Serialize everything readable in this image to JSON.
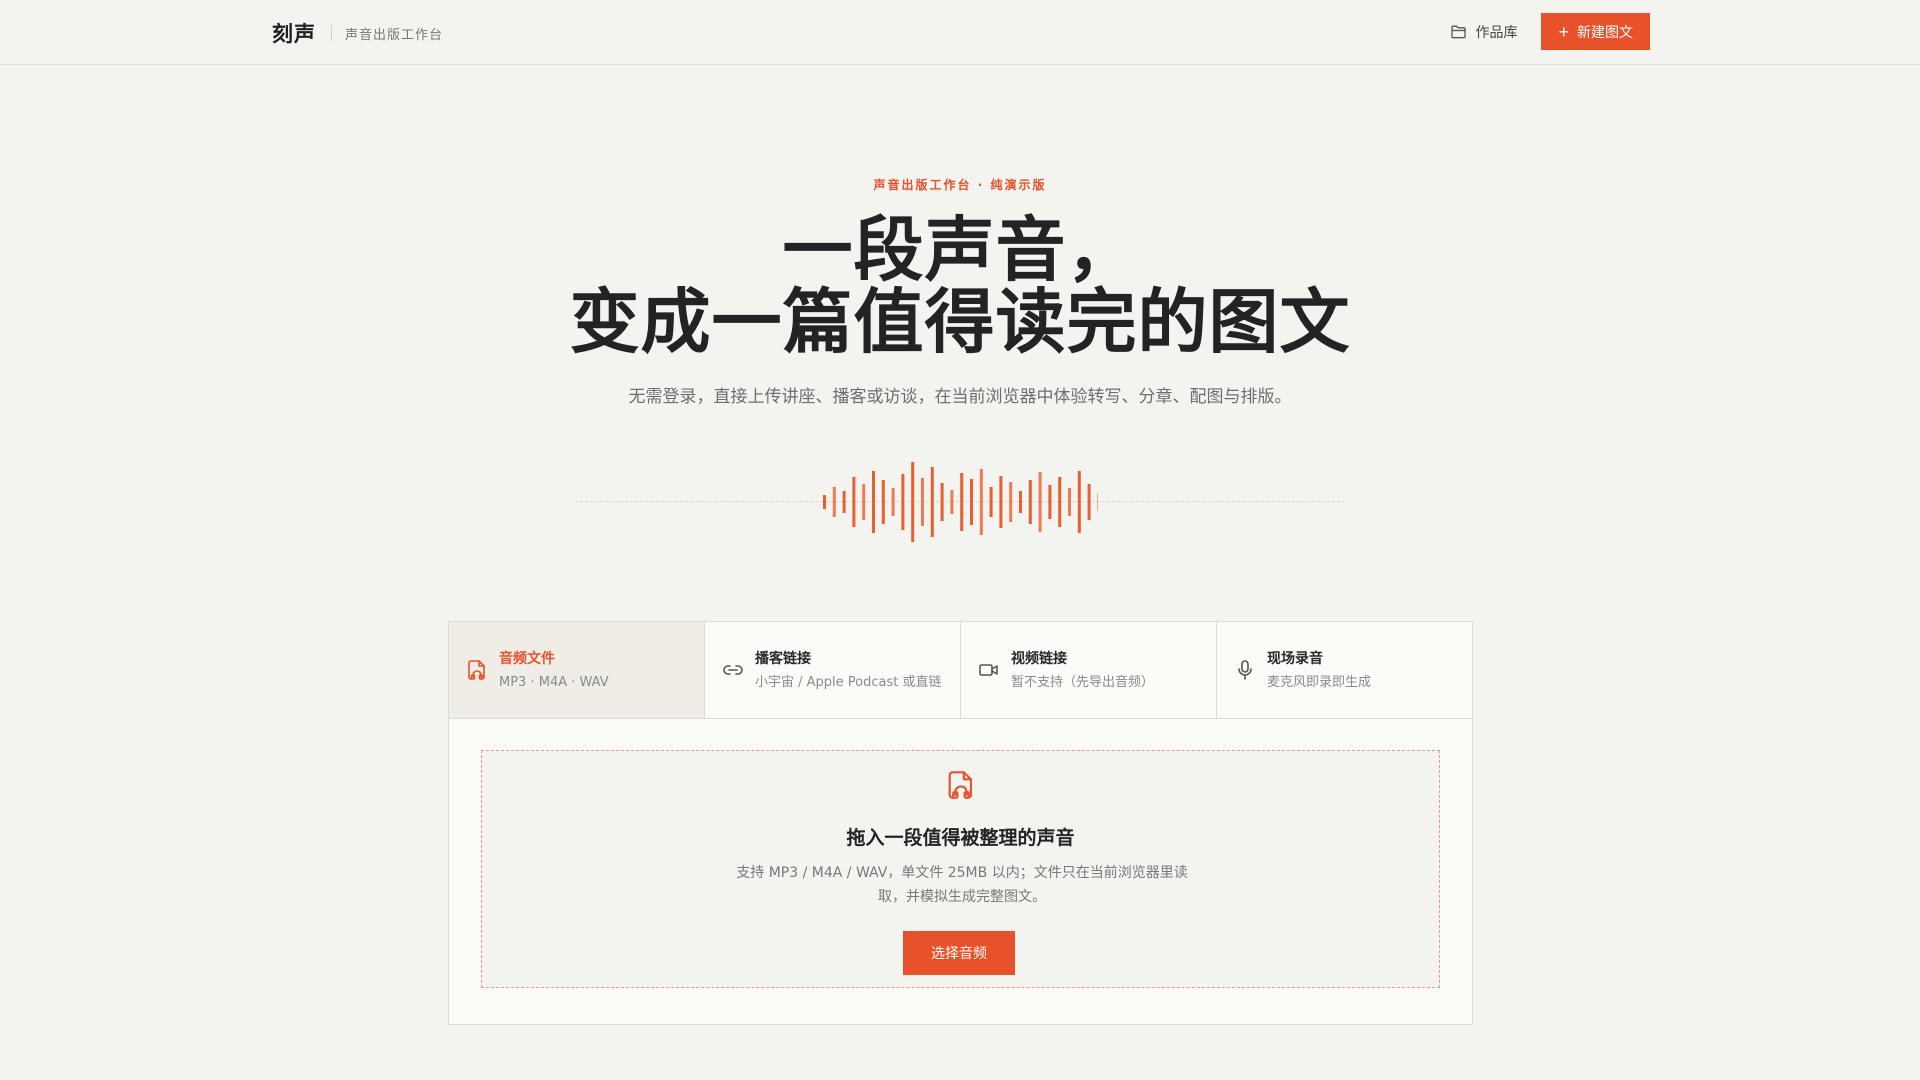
{
  "header": {
    "brand": "刻声",
    "subtitle": "声音出版工作台",
    "library_label": "作品库",
    "new_label": "新建图文"
  },
  "hero": {
    "eyebrow": "声音出版工作台 · 纯演示版",
    "title_line1": "一段声音，",
    "title_line2": "变成一篇值得读完的图文",
    "description": "无需登录，直接上传讲座、播客或访谈，在当前浏览器中体验转写、分章、配图与排版。"
  },
  "tabs": [
    {
      "title": "音频文件",
      "desc": "MP3 · M4A · WAV",
      "icon": "audio-file-icon",
      "active": true
    },
    {
      "title": "播客链接",
      "desc": "小宇宙 / Apple Podcast 或直链",
      "icon": "link-icon",
      "active": false
    },
    {
      "title": "视频链接",
      "desc": "暂不支持（先导出音频）",
      "icon": "video-icon",
      "active": false
    },
    {
      "title": "现场录音",
      "desc": "麦克风即录即生成",
      "icon": "microphone-icon",
      "active": false
    }
  ],
  "dropzone": {
    "title": "拖入一段值得被整理的声音",
    "description": "支持 MP3 / M4A / WAV，单文件 25MB 以内；文件只在当前浏览器里读取，并模拟生成完整图文。",
    "button_label": "选择音频"
  },
  "colors": {
    "accent": "#e8522a",
    "background": "#f3f3ef",
    "text": "#232323"
  }
}
